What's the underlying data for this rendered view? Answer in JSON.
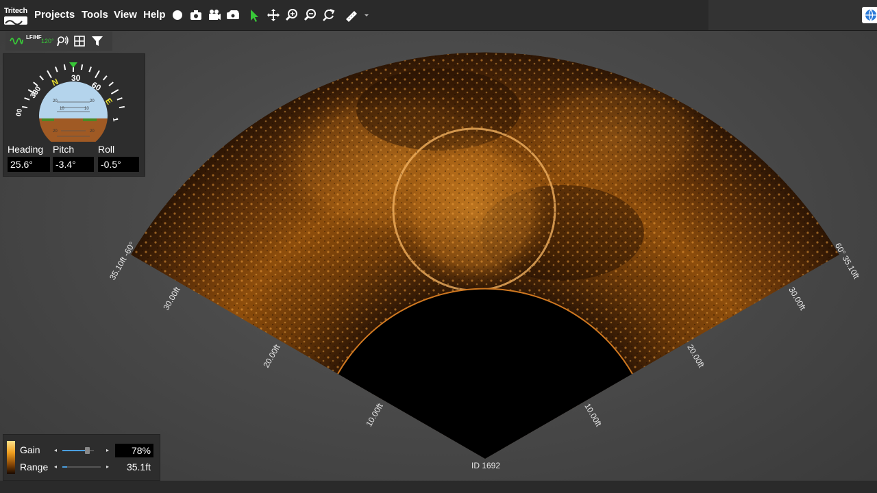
{
  "app": {
    "logo_text": "Tritech"
  },
  "menu": {
    "items": [
      "Projects",
      "Tools",
      "View",
      "Help"
    ]
  },
  "toolbar": {
    "icons": [
      "record-icon",
      "camera-icon",
      "video-camera-icon",
      "playback-icon",
      "pointer-icon",
      "pan-icon",
      "zoom-in-icon",
      "zoom-out-icon",
      "reset-view-icon",
      "measure-icon"
    ]
  },
  "subbar": {
    "freq_label": "LF/HF",
    "angle_label": "120°"
  },
  "attitude": {
    "compass_labels": [
      "00",
      "330",
      "N",
      "30",
      "60",
      "E",
      "1"
    ],
    "pitch_ticks": [
      "20",
      "10",
      "10",
      "20",
      "20",
      "20"
    ],
    "heading_label": "Heading",
    "pitch_label": "Pitch",
    "roll_label": "Roll",
    "heading_value": "25.6°",
    "pitch_value": "-3.4°",
    "roll_value": "-0.5°"
  },
  "sonar": {
    "id_label": "ID 1692",
    "left_labels": [
      "35.10ft -60°",
      "30.00ft",
      "20.00ft",
      "10.00ft"
    ],
    "right_labels": [
      "60° 35.10ft",
      "30.00ft",
      "20.00ft",
      "10.00ft"
    ],
    "accent_color": "#c07018"
  },
  "controls": {
    "gain_label": "Gain",
    "gain_value": "78%",
    "gain_level": 0.78,
    "range_label": "Range",
    "range_value": "35.1ft",
    "range_level": 0.12
  }
}
